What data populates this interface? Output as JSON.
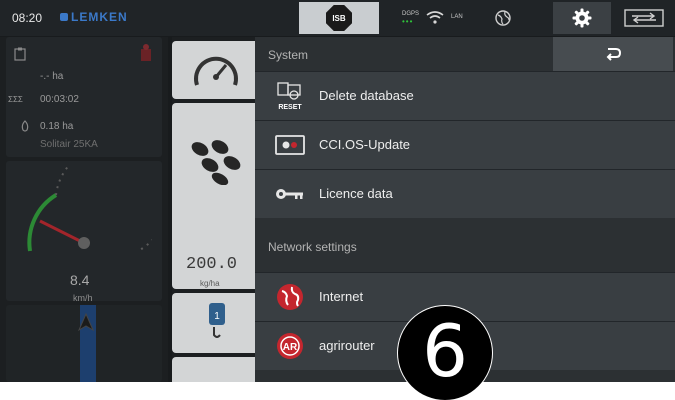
{
  "status_bar": {
    "time": "08:20",
    "brand": "LEMKEN",
    "isb_label": "ISB",
    "gps_label": "DGPS",
    "gps_dots": "•••",
    "lan_label": "LAN",
    "icons": [
      "isb-stop-icon",
      "wifi-icon",
      "globe-icon",
      "gear-icon",
      "screen-swap-icon"
    ]
  },
  "left_panel": {
    "area": "-.- ha",
    "time_label": "ΣΣΣ",
    "time": "00:03:02",
    "worked_area": "0.18 ha",
    "machine": "Solitair 25KA",
    "speed": "8.4",
    "speed_unit": "km/h"
  },
  "middle_panel": {
    "rate_value": "200.0",
    "rate_unit": "kg/ha"
  },
  "menu": {
    "system_header": "System",
    "items_system": [
      {
        "label": "Delete database",
        "icon": "reset-database-icon",
        "icon_text": "RESET"
      },
      {
        "label": "CCI.OS-Update",
        "icon": "update-icon"
      },
      {
        "label": "Licence data",
        "icon": "key-icon"
      }
    ],
    "network_header": "Network settings",
    "items_network": [
      {
        "label": "Internet",
        "icon": "internet-globe-icon"
      },
      {
        "label": "agrirouter",
        "icon": "agrirouter-icon",
        "icon_text": "AR"
      }
    ],
    "back_icon": "back-arrow-icon"
  },
  "badge": {
    "number": "6"
  },
  "colors": {
    "accent_blue": "#3b79c9",
    "menu_bg": "#2c3033",
    "item_bg": "#393e42",
    "gps_green": "#2fc23a",
    "internet_red": "#c4262e"
  }
}
